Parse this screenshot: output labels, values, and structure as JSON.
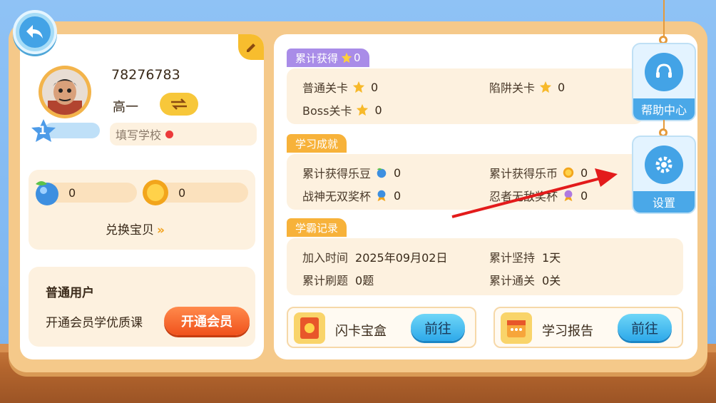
{
  "profile": {
    "user_id": "78276783",
    "grade": "高一",
    "level": "1",
    "school_placeholder": "填写学校"
  },
  "wallet": {
    "beans": "0",
    "coins": "0",
    "exchange_label": "兑换宝贝",
    "exchange_arrow": "»"
  },
  "membership": {
    "title": "普通用户",
    "desc": "开通会员学优质课",
    "button": "开通会员"
  },
  "sections": {
    "earned": {
      "title": "累计获得",
      "title_count": "0",
      "items": [
        {
          "label": "普通关卡",
          "value": "0",
          "icon": "star-icon"
        },
        {
          "label": "陷阱关卡",
          "value": "0",
          "icon": "star-icon"
        },
        {
          "label": "Boss关卡",
          "value": "0",
          "icon": "star-icon"
        }
      ]
    },
    "achievements": {
      "title": "学习成就",
      "items": [
        {
          "label": "累计获得乐豆",
          "value": "0",
          "icon": "bean-icon"
        },
        {
          "label": "累计获得乐币",
          "value": "0",
          "icon": "coin-icon"
        },
        {
          "label": "战神无双奖杯",
          "value": "0",
          "icon": "medal-icon"
        },
        {
          "label": "忍者无敌奖杯",
          "value": "0",
          "icon": "medal-icon"
        }
      ]
    },
    "records": {
      "title": "学霸记录",
      "items": [
        {
          "label": "加入时间",
          "value": "2025年09月02日"
        },
        {
          "label": "累计坚持",
          "value": "1天"
        },
        {
          "label": "累计刷题",
          "value": "0题"
        },
        {
          "label": "累计通关",
          "value": "0关"
        }
      ]
    }
  },
  "cards": [
    {
      "label": "闪卡宝盒",
      "button": "前往",
      "icon": "card-box-icon"
    },
    {
      "label": "学习报告",
      "button": "前往",
      "icon": "calendar-report-icon"
    }
  ],
  "side": {
    "help": "帮助中心",
    "settings": "设置"
  },
  "colors": {
    "accent_blue": "#43a3e6",
    "accent_orange": "#f0521c",
    "tag_purple": "#a98ce8",
    "tag_orange": "#f7b23a",
    "annotation_red": "#e31b1b"
  }
}
